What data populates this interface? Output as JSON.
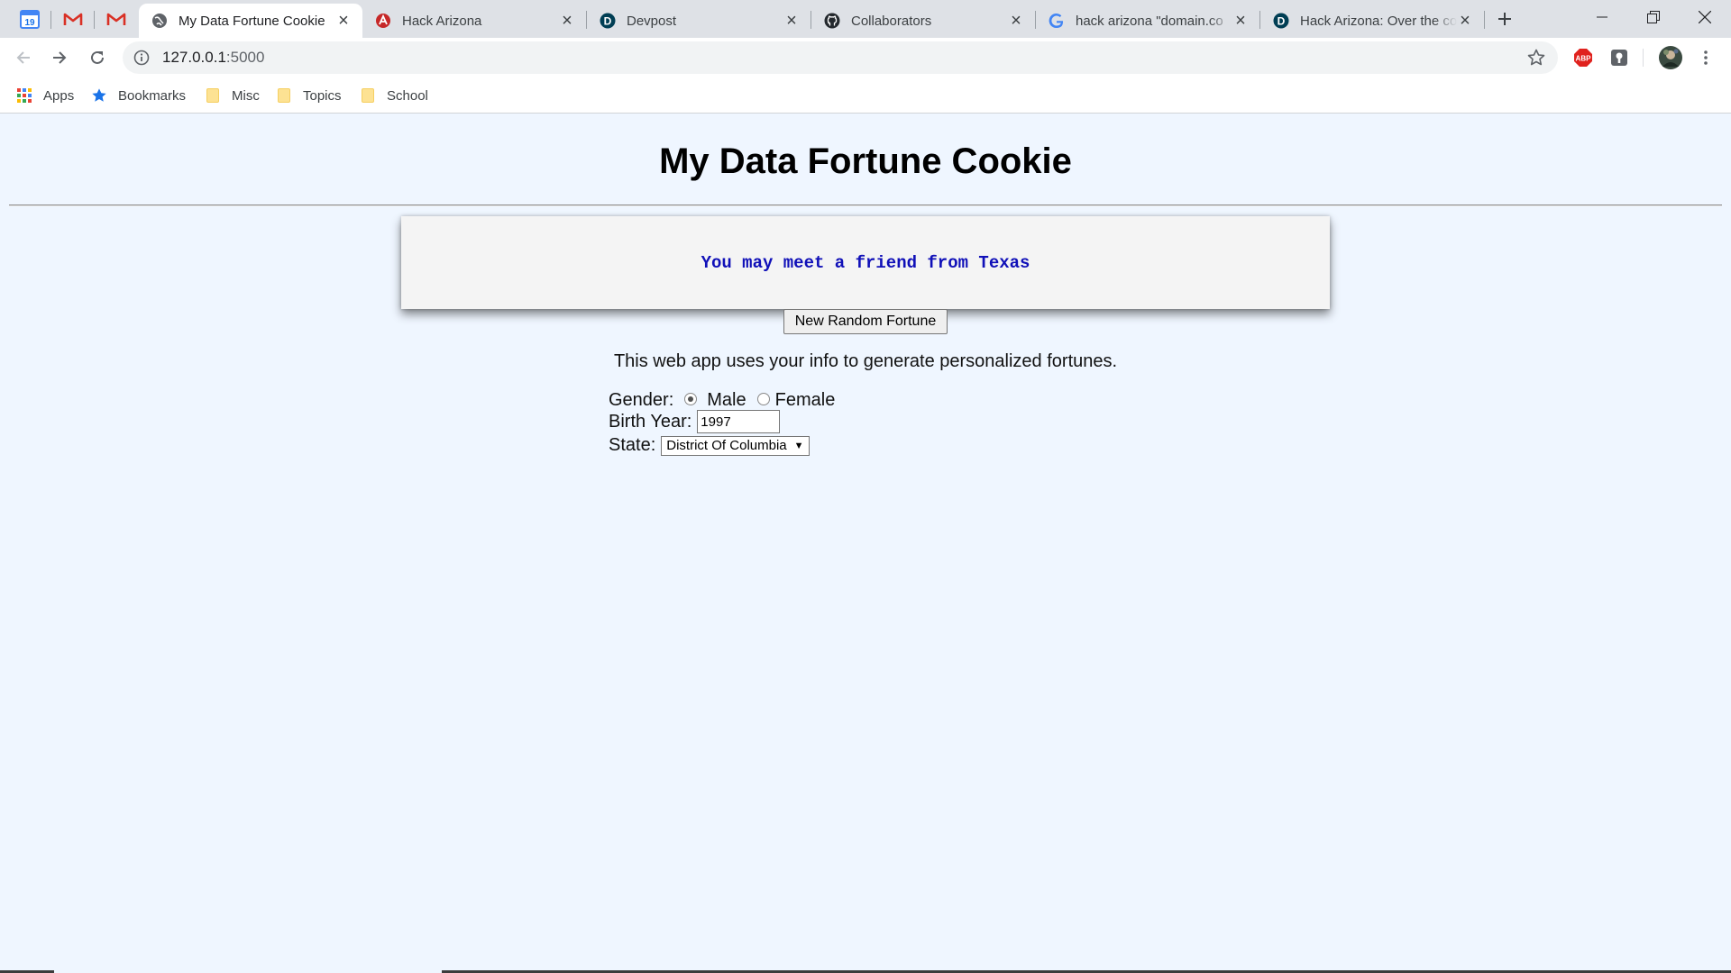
{
  "browser": {
    "pinned_tabs": [
      {
        "name": "Google Calendar",
        "icon": "calendar-icon",
        "badge": "19"
      },
      {
        "name": "Gmail",
        "icon": "gmail-icon"
      },
      {
        "name": "Gmail",
        "icon": "gmail-icon"
      }
    ],
    "tabs": [
      {
        "title": "My Data Fortune Cookie",
        "icon": "globe-icon",
        "active": true
      },
      {
        "title": "Hack Arizona",
        "icon": "hack-arizona-icon",
        "active": false
      },
      {
        "title": "Devpost",
        "icon": "devpost-icon",
        "active": false
      },
      {
        "title": "Collaborators",
        "icon": "github-icon",
        "active": false
      },
      {
        "title": "hack arizona \"domain.co",
        "icon": "google-icon",
        "active": false
      },
      {
        "title": "Hack Arizona: Over the co",
        "icon": "devpost-icon",
        "active": false
      }
    ],
    "address": {
      "host": "127.0.0.1",
      "port": ":5000"
    },
    "extensions": [
      "adblock-icon",
      "privacy-extension-icon",
      "profile-avatar",
      "menu-icon"
    ],
    "bookmarks": [
      {
        "label": "Apps",
        "icon": "apps-grid-icon"
      },
      {
        "label": "Bookmarks",
        "icon": "star-icon"
      },
      {
        "label": "Misc",
        "icon": "folder-icon"
      },
      {
        "label": "Topics",
        "icon": "folder-icon"
      },
      {
        "label": "School",
        "icon": "folder-icon"
      }
    ]
  },
  "page": {
    "title": "My Data Fortune Cookie",
    "fortune": "You may meet a friend from Texas",
    "new_fortune_button": "New Random Fortune",
    "intro": "This web app uses your info to generate personalized fortunes.",
    "form": {
      "gender_label": "Gender:",
      "gender_options": [
        "Male",
        "Female"
      ],
      "gender_selected": "Male",
      "birth_year_label": "Birth Year:",
      "birth_year_value": "1997",
      "state_label": "State:",
      "state_value": "District Of Columbia"
    }
  },
  "colors": {
    "page_background": "#eff6ff",
    "fortune_text": "#1010b8",
    "fortune_box": "#f4f4f4"
  }
}
